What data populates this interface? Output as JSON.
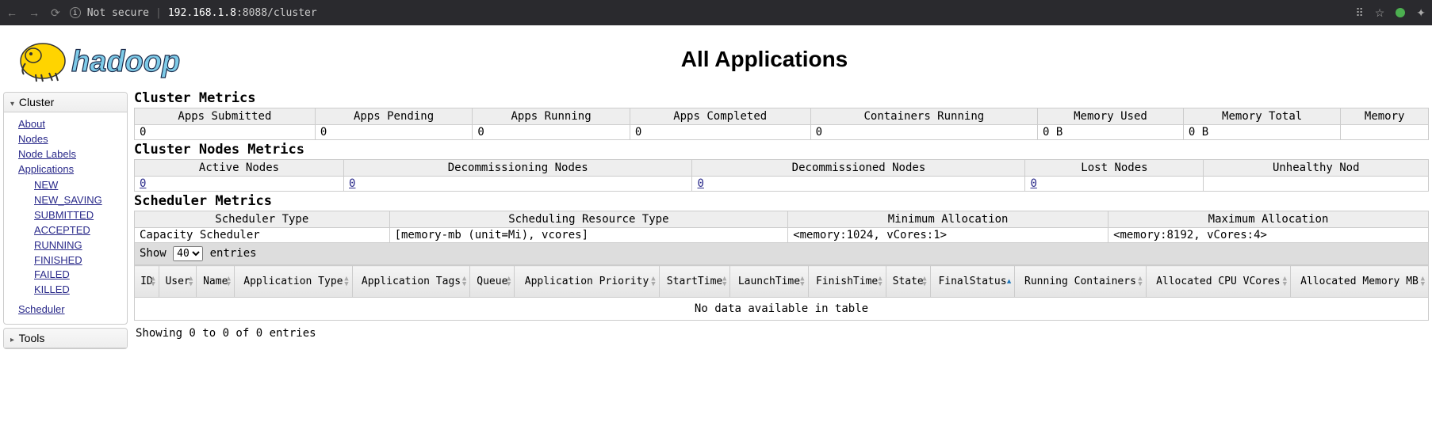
{
  "browser": {
    "not_secure": "Not secure",
    "url_host": "192.168.1.8",
    "url_rest": ":8088/cluster"
  },
  "page_title": "All Applications",
  "sidebar": {
    "cluster": {
      "title": "Cluster",
      "about": "About",
      "nodes": "Nodes",
      "node_labels": "Node Labels",
      "applications": "Applications",
      "states": {
        "new": "NEW",
        "new_saving": "NEW_SAVING",
        "submitted": "SUBMITTED",
        "accepted": "ACCEPTED",
        "running": "RUNNING",
        "finished": "FINISHED",
        "failed": "FAILED",
        "killed": "KILLED"
      },
      "scheduler": "Scheduler"
    },
    "tools": {
      "title": "Tools"
    }
  },
  "cluster_metrics": {
    "title": "Cluster Metrics",
    "headers": {
      "apps_submitted": "Apps Submitted",
      "apps_pending": "Apps Pending",
      "apps_running": "Apps Running",
      "apps_completed": "Apps Completed",
      "containers_running": "Containers Running",
      "memory_used": "Memory Used",
      "memory_total": "Memory Total",
      "memory_more": "Memory"
    },
    "values": {
      "apps_submitted": "0",
      "apps_pending": "0",
      "apps_running": "0",
      "apps_completed": "0",
      "containers_running": "0",
      "memory_used": "0 B",
      "memory_total": "0 B"
    }
  },
  "nodes_metrics": {
    "title": "Cluster Nodes Metrics",
    "headers": {
      "active": "Active Nodes",
      "decommissioning": "Decommissioning Nodes",
      "decommissioned": "Decommissioned Nodes",
      "lost": "Lost Nodes",
      "unhealthy": "Unhealthy Nod"
    },
    "values": {
      "active": "0",
      "decommissioning": "0",
      "decommissioned": "0",
      "lost": "0"
    }
  },
  "scheduler_metrics": {
    "title": "Scheduler Metrics",
    "headers": {
      "type": "Scheduler Type",
      "resource_type": "Scheduling Resource Type",
      "min": "Minimum Allocation",
      "max": "Maximum Allocation"
    },
    "values": {
      "type": "Capacity Scheduler",
      "resource_type": "[memory-mb (unit=Mi), vcores]",
      "min": "<memory:1024, vCores:1>",
      "max": "<memory:8192, vCores:4>"
    }
  },
  "entries": {
    "show": "Show",
    "value": "40",
    "entries": "entries"
  },
  "apps_table": {
    "headers": {
      "id": "ID",
      "user": "User",
      "name": "Name",
      "app_type": "Application Type",
      "app_tags": "Application Tags",
      "queue": "Queue",
      "priority": "Application Priority",
      "start": "StartTime",
      "launch": "LaunchTime",
      "finish": "FinishTime",
      "state": "State",
      "final": "FinalStatus",
      "running_containers": "Running Containers",
      "cpu": "Allocated CPU VCores",
      "mem": "Allocated Memory MB"
    },
    "empty": "No data available in table"
  },
  "footer": "Showing 0 to 0 of 0 entries"
}
